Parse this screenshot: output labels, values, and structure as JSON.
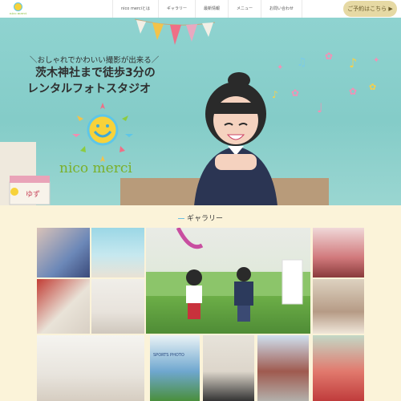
{
  "header": {
    "logo_text": "nico merci",
    "nav": [
      "nico merciとは",
      "ギャラリー",
      "最新情報",
      "メニュー",
      "お問い合わせ"
    ],
    "reserve_label": "ご予約はこちら ▶"
  },
  "hero": {
    "lead": "＼おしゃれでかわいい撮影が出来る／",
    "title_line1": "茨木神社まで徒歩3分の",
    "title_line2": "レンタルフォトスタジオ",
    "brand": "nico merci",
    "clapper_text": "ゆず"
  },
  "gallery": {
    "title": "ギャラリー",
    "sign_text": "SPORTS PHOTO"
  },
  "colors": {
    "accent_beige": "#e6d9a4",
    "brand_green": "#7bb02a",
    "sky": "#8fd3d0",
    "page_bg": "#fbf3d9"
  },
  "icons": [
    "sun-smile-icon",
    "music-note-icon",
    "star-icon",
    "flower-icon"
  ]
}
